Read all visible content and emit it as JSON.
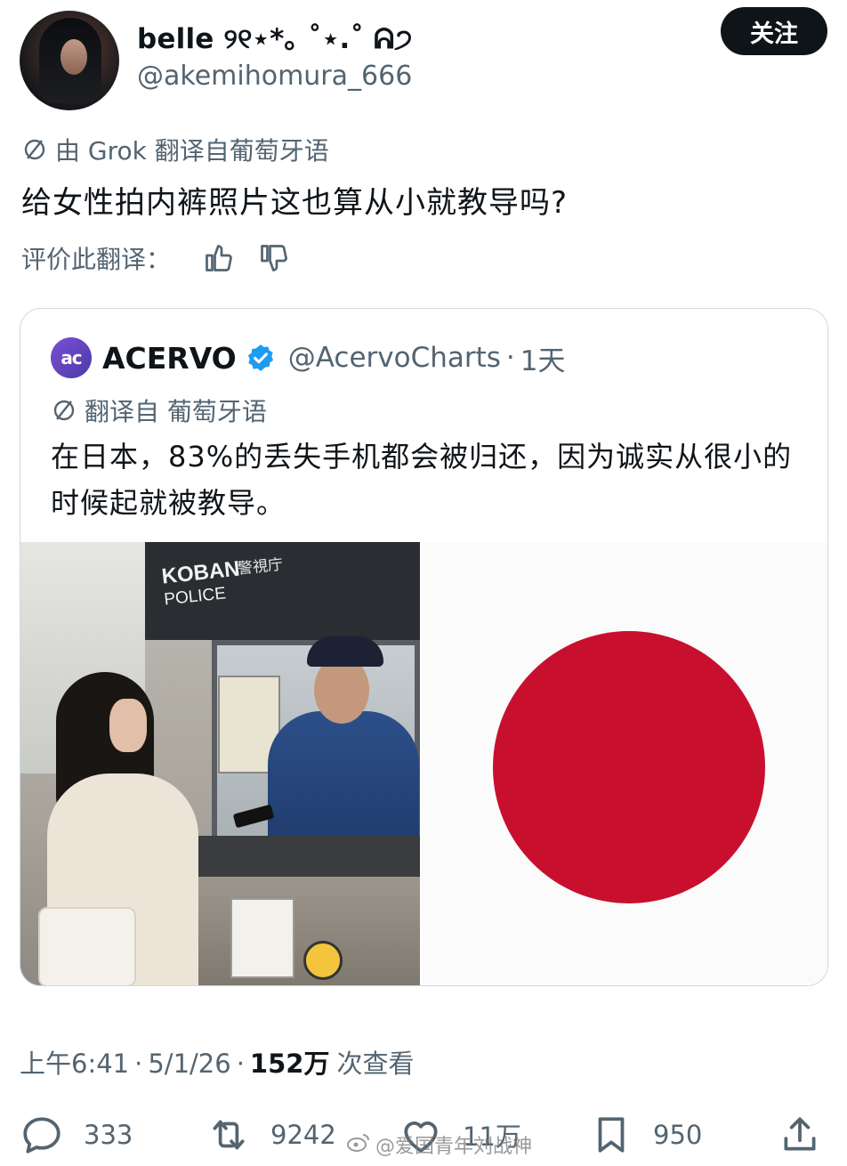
{
  "author": {
    "display_name": "belle ୨୧⋆*｡ ˚⋆.˚ ᕱ੭",
    "handle": "@akemihomura_666",
    "follow_label": "关注"
  },
  "translation": {
    "note": "由 Grok 翻译自葡萄牙语",
    "text": "给女性拍内裤照片这也算从小就教导吗?",
    "rate_label": "评价此翻译："
  },
  "quote": {
    "avatar_text": "ac",
    "name": "ACERVO",
    "handle": "@AcervoCharts",
    "separator": "·",
    "time": "1天",
    "translation_note": "翻译自 葡萄牙语",
    "text": "在日本，83%的丢失手机都会被归还，因为诚实从很小的时候起就被教导。",
    "photo_sign": {
      "koban": "KOBAN",
      "police": "POLICE",
      "kanji": "警視庁"
    }
  },
  "footer": {
    "time": "上午6:41",
    "sep1": "·",
    "date": "5/1/26",
    "sep2": "·",
    "views_count": "152万",
    "views_label": "次查看"
  },
  "actions": {
    "replies": "333",
    "reposts": "9242",
    "likes": "11万",
    "bookmarks": "950"
  },
  "watermark": "@爱国青年刘战神",
  "colors": {
    "text": "#0f1419",
    "secondary": "#536471",
    "verified": "#1d9bf0",
    "flag_red": "#c8102e",
    "border": "#cfd9de"
  },
  "icons": [
    "avatar",
    "translate-slash-icon",
    "thumbs-up-icon",
    "thumbs-down-icon",
    "verified-badge-icon",
    "reply-icon",
    "repost-icon",
    "like-icon",
    "bookmark-icon",
    "share-icon"
  ]
}
